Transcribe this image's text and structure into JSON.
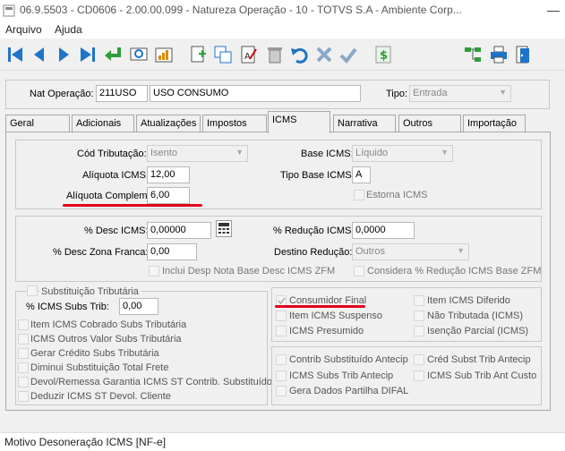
{
  "window": {
    "title": "06.9.5503 - CD0606 - 2.00.00.099 - Natureza Operação - 10 - TOTVS S.A - Ambiente Corp..."
  },
  "menu": [
    "Arquivo",
    "Ajuda"
  ],
  "header": {
    "nat_label": "Nat Operação:",
    "nat_code": "211USO",
    "nat_desc": "USO CONSUMO",
    "tipo_label": "Tipo:",
    "tipo_value": "Entrada"
  },
  "tabs": [
    "Geral",
    "Adicionais",
    "Atualizações",
    "Impostos",
    "ICMS",
    "Narrativa",
    "Outros",
    "Importação"
  ],
  "icms": {
    "cod_trib_label": "Cód Tributação:",
    "cod_trib_value": "Isento",
    "base_icms_label": "Base ICMS:",
    "base_icms_value": "Líquido",
    "aliquota_label": "Alíquota ICMS:",
    "aliquota_value": "12,00",
    "tipo_base_label": "Tipo Base ICMS:",
    "tipo_base_value": "A",
    "aliq_compl_label": "Alíquota Complem:",
    "aliq_compl_value": "6,00",
    "estorna_label": "Estorna ICMS",
    "desc_icms_label": "% Desc ICMS:",
    "desc_icms_value": "0,00000",
    "reducao_label": "% Redução ICMS:",
    "reducao_value": "0,0000",
    "desc_zf_label": "% Desc Zona Franca:",
    "desc_zf_value": "0,00",
    "destino_label": "Destino Redução:",
    "destino_value": "Outros",
    "inclui_desp_label": "Inclui Desp Nota Base Desc ICMS ZFM",
    "considera_label": "Considera % Redução ICMS Base ZFM"
  },
  "subst": {
    "group_label": "Substituição Tributária",
    "icms_subs_trib_label": "% ICMS Subs Trib:",
    "icms_subs_trib_value": "0,00",
    "checks": [
      "Item ICMS Cobrado Subs Tributária",
      "ICMS Outros Valor Subs Tributária",
      "Gerar Crédito Subs Tributária",
      "Diminui Substituição Total Frete",
      "Devol/Remessa Garantia ICMS ST Contrib. Substituído",
      "Deduzir ICMS ST Devol. Cliente"
    ]
  },
  "right_group1": {
    "consumidor_final": "Consumidor Final",
    "item_icms_suspenso": "Item ICMS Suspenso",
    "icms_presumido": "ICMS Presumido",
    "item_icms_diferido": "Item ICMS Diferido",
    "nao_tributada": "Não Tributada (ICMS)",
    "isencao_parcial": "Isenção Parcial (ICMS)"
  },
  "right_group2": {
    "contrib_subst": "Contrib Substituído Antecip",
    "icms_subs_antecip": "ICMS Subs Trib Antecip",
    "gera_dados": "Gera Dados Partilha DIFAL",
    "cred_subst": "Créd Subst Trib Antecip",
    "icms_sub_ant_custo": "ICMS Sub Trib Ant Custo"
  },
  "status": {
    "text": "Motivo Desoneração ICMS [NF-e]"
  },
  "colors": {
    "accent_red": "#e0001b",
    "toolbar_blue": "#1e74c8",
    "toolbar_green": "#2e9e3a"
  }
}
